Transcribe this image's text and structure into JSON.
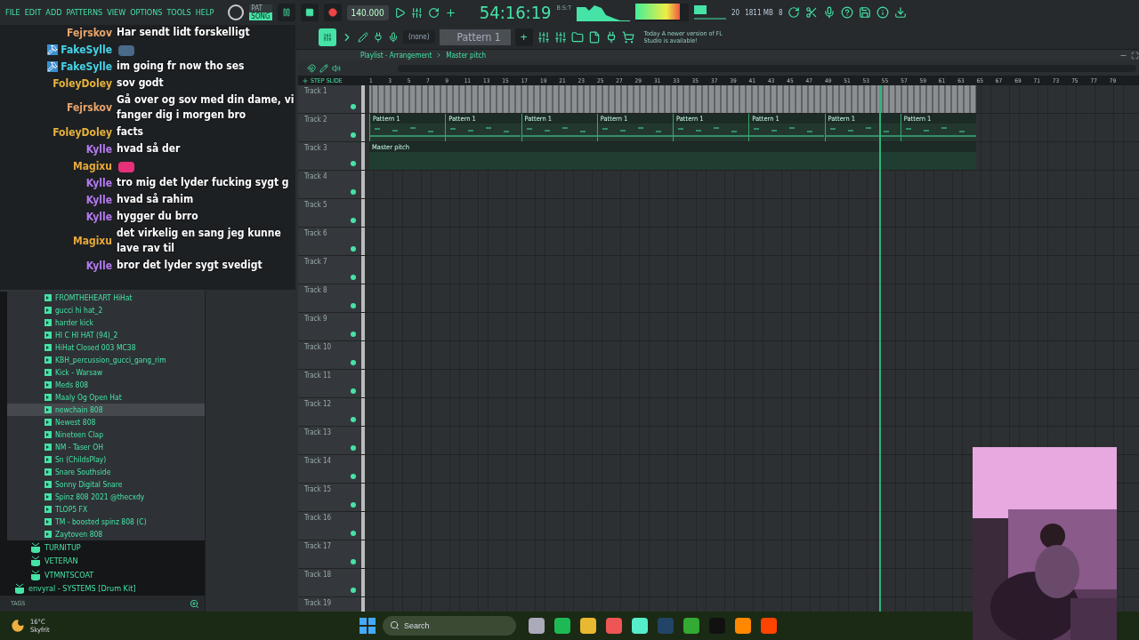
{
  "menu": [
    "FILE",
    "EDIT",
    "ADD",
    "PATTERNS",
    "VIEW",
    "OPTIONS",
    "TOOLS",
    "HELP"
  ],
  "transport": {
    "modes": [
      {
        "label": "PAT",
        "selected": false
      },
      {
        "label": "SONG",
        "selected": true
      }
    ],
    "tempo": "140.000",
    "time": "54:16:19",
    "time_unit": "B:S:T"
  },
  "monitor": {
    "cpu": "20",
    "memory": "1811 MB",
    "polyphony": "8"
  },
  "pattern_bar": {
    "preset": "(none)",
    "pattern": "Pattern 1",
    "add": "+"
  },
  "news": {
    "date": "Today",
    "text": "A newer version of FL Studio is available!"
  },
  "chat": [
    {
      "kind": "text",
      "user": "Fejrskov",
      "color": "#e8a36a",
      "badge": false,
      "text": "Har sendt lidt forskelligt"
    },
    {
      "kind": "emote",
      "user": "FakeSylle",
      "color": "#45d3e6",
      "badge": true
    },
    {
      "kind": "text",
      "user": "FakeSylle",
      "color": "#45d3e6",
      "badge": true,
      "text": "im going fr now tho ses"
    },
    {
      "kind": "text",
      "user": "FoleyDoley",
      "color": "#e6b23a",
      "badge": false,
      "text": "sov godt"
    },
    {
      "kind": "text",
      "user": "Fejrskov",
      "color": "#e8a36a",
      "badge": false,
      "text": "Gå over og sov med din dame, vi fanger dig i morgen bro"
    },
    {
      "kind": "text",
      "user": "FoleyDoley",
      "color": "#e6b23a",
      "badge": false,
      "text": "facts"
    },
    {
      "kind": "text",
      "user": "Kylle",
      "color": "#b57af2",
      "badge": false,
      "text": "hvad så der"
    },
    {
      "kind": "emote",
      "user": "Magixu",
      "color": "#e6a93a",
      "badge": false
    },
    {
      "kind": "text",
      "user": "Kylle",
      "color": "#b57af2",
      "badge": false,
      "text": "tro mig det lyder fucking sygt g"
    },
    {
      "kind": "text",
      "user": "Kylle",
      "color": "#b57af2",
      "badge": false,
      "text": "hvad så rahim"
    },
    {
      "kind": "text",
      "user": "Kylle",
      "color": "#b57af2",
      "badge": false,
      "text": "hygger du brro"
    },
    {
      "kind": "text",
      "user": "Magixu",
      "color": "#e6a93a",
      "badge": false,
      "text": "det virkelig en sang jeg kunne lave rav til"
    },
    {
      "kind": "text",
      "user": "Kylle",
      "color": "#b57af2",
      "badge": false,
      "text": "bror det lyder sygt svedigt"
    }
  ],
  "browser": {
    "tree": [
      {
        "kind": "hidden",
        "children": [
          {
            "kind": "hidden",
            "children": [
              {
                "kind": "file",
                "label": "FROMTHEHEART HiHat",
                "selected": false
              },
              {
                "kind": "file",
                "label": "gucci hi hat_2",
                "selected": false
              },
              {
                "kind": "file",
                "label": "harder kick",
                "selected": false
              },
              {
                "kind": "file",
                "label": "HI C HI HAT (94)_2",
                "selected": false
              },
              {
                "kind": "file",
                "label": "HiHat Closed 003 MC38",
                "selected": false
              },
              {
                "kind": "file",
                "label": "KBH_percussion_gucci_gang_rim",
                "selected": false
              },
              {
                "kind": "file",
                "label": "Kick - Warsaw",
                "selected": false
              },
              {
                "kind": "file",
                "label": "Meds 808",
                "selected": false
              },
              {
                "kind": "file",
                "label": "Maaly Og Open Hat",
                "selected": false
              },
              {
                "kind": "file",
                "label": "newchain 808",
                "selected": true
              },
              {
                "kind": "file",
                "label": "Newest 808",
                "selected": false
              },
              {
                "kind": "file",
                "label": "Nineteen Clap",
                "selected": false
              },
              {
                "kind": "file",
                "label": "NM - Taser OH",
                "selected": false
              },
              {
                "kind": "file",
                "label": "Sn (ChildsPlay)",
                "selected": false
              },
              {
                "kind": "file",
                "label": "Snare Southside",
                "selected": false
              },
              {
                "kind": "file",
                "label": "Sonny Digital  Snare",
                "selected": false
              },
              {
                "kind": "file",
                "label": "Spinz 808 2021 @thecxdy",
                "selected": false
              },
              {
                "kind": "file",
                "label": "TLOP5 FX",
                "selected": false
              },
              {
                "kind": "file",
                "label": "TM - boosted spinz 808 (C)",
                "selected": false
              },
              {
                "kind": "file",
                "label": "Zaytoven 808",
                "selected": false
              }
            ]
          },
          {
            "kind": "folder",
            "label": "TURNITUP"
          },
          {
            "kind": "folder",
            "label": "VETERAN"
          },
          {
            "kind": "folder",
            "label": "VTMNTSCOAT"
          }
        ]
      },
      {
        "kind": "folder",
        "label": "envyral - SYSTEMS [Drum Kit]"
      }
    ],
    "tags": "TAGS"
  },
  "playlist": {
    "title": "Playlist - Arrangement",
    "crumb": "Master pitch",
    "step": "STEP",
    "slide": "SLIDE",
    "ruler": [
      "1",
      "3",
      "5",
      "7",
      "9",
      "11",
      "13",
      "15",
      "17",
      "19",
      "21",
      "23",
      "25",
      "27",
      "29",
      "31",
      "33",
      "35",
      "37",
      "39",
      "41",
      "43",
      "45",
      "47",
      "49",
      "51",
      "53",
      "55",
      "57",
      "59",
      "61",
      "63",
      "65",
      "67",
      "69",
      "71",
      "73",
      "75",
      "77",
      "79"
    ],
    "tracks": [
      {
        "name": "Track 1",
        "clips": [
          {
            "kind": "audio"
          }
        ]
      },
      {
        "name": "Track 2",
        "clips": [
          {
            "kind": "pattern",
            "label": "Pattern 1"
          },
          {
            "kind": "pattern",
            "label": "Pattern 1"
          },
          {
            "kind": "pattern",
            "label": "Pattern 1"
          },
          {
            "kind": "pattern",
            "label": "Pattern 1"
          },
          {
            "kind": "pattern",
            "label": "Pattern 1"
          },
          {
            "kind": "pattern",
            "label": "Pattern 1"
          },
          {
            "kind": "pattern",
            "label": "Pattern 1"
          },
          {
            "kind": "pattern",
            "label": "Pattern 1"
          }
        ]
      },
      {
        "name": "Track 3",
        "clips": [
          {
            "kind": "automation",
            "label": "Master pitch"
          }
        ]
      },
      {
        "name": "Track 4"
      },
      {
        "name": "Track 5"
      },
      {
        "name": "Track 6"
      },
      {
        "name": "Track 7"
      },
      {
        "name": "Track 8"
      },
      {
        "name": "Track 9"
      },
      {
        "name": "Track 10"
      },
      {
        "name": "Track 11"
      },
      {
        "name": "Track 12"
      },
      {
        "name": "Track 13"
      },
      {
        "name": "Track 14"
      },
      {
        "name": "Track 15"
      },
      {
        "name": "Track 16"
      },
      {
        "name": "Track 17"
      },
      {
        "name": "Track 18"
      },
      {
        "name": "Track 19"
      }
    ]
  },
  "taskbar": {
    "temperature": "16°C",
    "weather": "Skyfrit",
    "search_placeholder": "Search"
  }
}
